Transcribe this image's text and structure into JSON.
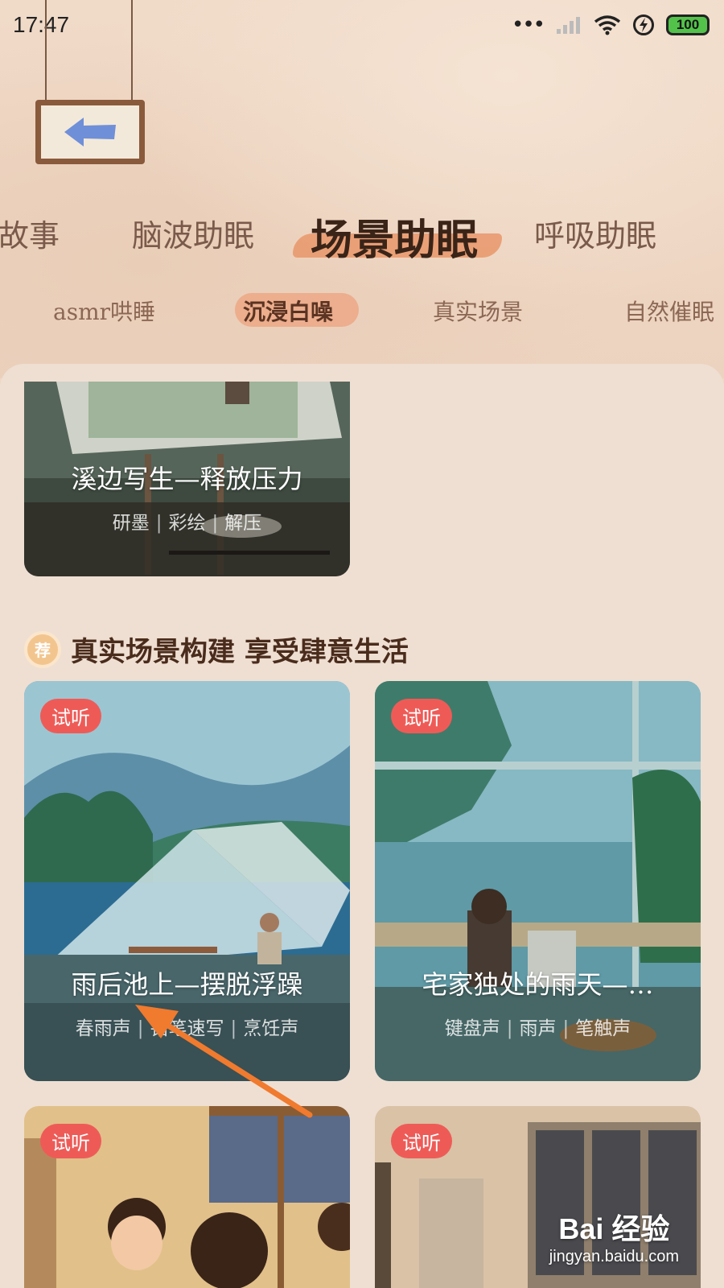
{
  "status_bar": {
    "time": "17:47",
    "battery": "100",
    "icons": [
      "more-dots-icon",
      "signal-icon",
      "wifi-icon",
      "charging-icon",
      "battery-icon"
    ]
  },
  "nav": {
    "back_icon": "back-arrow-icon"
  },
  "category_tabs": [
    {
      "label": "睡故事"
    },
    {
      "label": "脑波助眠"
    },
    {
      "label": "场景助眠",
      "active": true
    },
    {
      "label": "呼吸助眠"
    }
  ],
  "sub_tabs": [
    {
      "label": "asmr哄睡"
    },
    {
      "label": "沉浸白噪",
      "active": true
    },
    {
      "label": "真实场景"
    },
    {
      "label": "自然催眠"
    }
  ],
  "featured_card": {
    "title": "溪边写生—释放压力",
    "tags": [
      "研墨",
      "彩绘",
      "解压"
    ]
  },
  "section": {
    "icon_text": "荐",
    "title": "真实场景构建 享受肆意生活"
  },
  "cards": [
    {
      "badge": "试听",
      "title": "雨后池上—摆脱浮躁",
      "tags": [
        "春雨声",
        "铅笔速写",
        "烹饪声"
      ]
    },
    {
      "badge": "试听",
      "title": "宅家独处的雨天—…",
      "tags": [
        "键盘声",
        "雨声",
        "笔触声"
      ]
    },
    {
      "badge": "试听"
    },
    {
      "badge": "试听"
    }
  ],
  "watermark": {
    "brand": "Bai 经验",
    "url": "jingyan.baidu.com"
  },
  "colors": {
    "accent_brush": "#e9976a",
    "badge_red": "#ee5b57",
    "annotation_arrow": "#f07a2e",
    "panel_bg": "#efdfd2"
  }
}
